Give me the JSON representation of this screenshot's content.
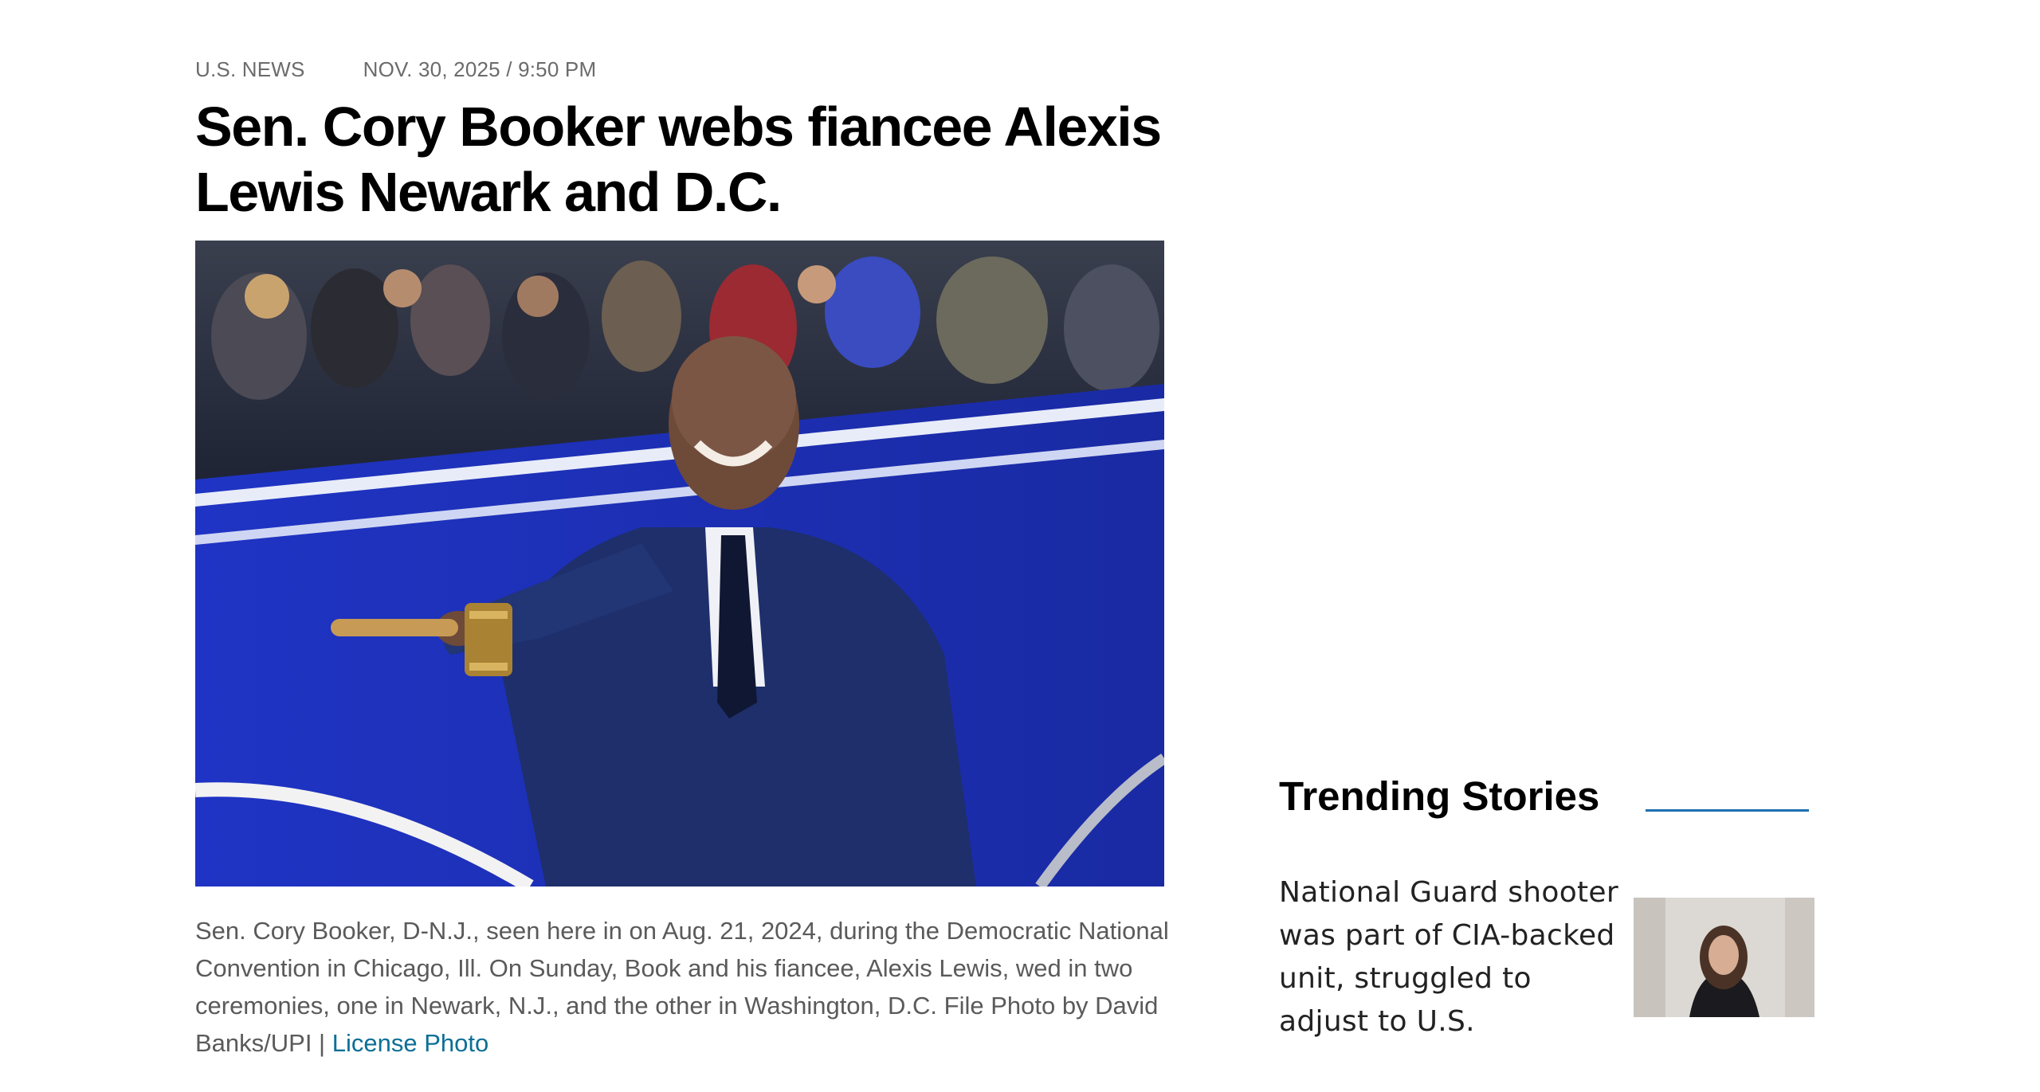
{
  "article": {
    "section": "U.S. NEWS",
    "dateline": "NOV. 30, 2025 / 9:50 PM",
    "headline": "Sen. Cory Booker webs fiancee Alexis Lewis Newark and D.C.",
    "hero_photo": {
      "alt": "Photo"
    },
    "caption_text": "Sen. Cory Booker, D-N.J., seen here in on Aug. 21, 2024, during the Democratic National Convention in Chicago, Ill. On Sunday, Book and his fiancee, Alexis Lewis, wed in two ceremonies, one in Newark, N.J., and the other in Washington, D.C. File Photo by David Banks/UPI | ",
    "license_link": "License Photo"
  },
  "sidebar": {
    "trending_title": "Trending Stories",
    "stories": [
      {
        "title": "National Guard shooter was part of CIA-backed unit, struggled to adjust to U.S."
      }
    ]
  },
  "colors": {
    "accent_link": "#0b6f96",
    "rule_blue": "#1f6fae",
    "stage_blue": "#1c2fb5"
  }
}
